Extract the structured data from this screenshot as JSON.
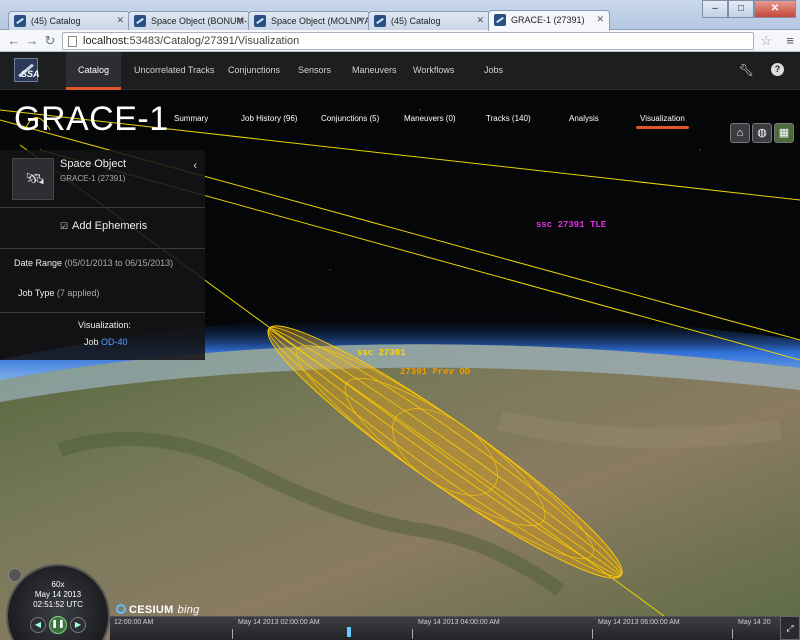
{
  "browser": {
    "tabs": [
      {
        "label": "(45) Catalog"
      },
      {
        "label": "Space Object (BONUM-1)"
      },
      {
        "label": "Space Object (MOLNIYA 1-"
      },
      {
        "label": "(45) Catalog"
      },
      {
        "label": "GRACE-1 (27391)"
      }
    ],
    "url_host": "localhost",
    "url_rest": ":53483/Catalog/27391/Visualization",
    "minimize": "–",
    "maximize": "□",
    "close": "✕"
  },
  "nav": {
    "items": [
      "Catalog",
      "Uncorrelated Tracks",
      "Conjunctions",
      "Sensors",
      "Maneuvers",
      "Workflows",
      "Jobs"
    ],
    "logo_text": "SSA",
    "help": "?"
  },
  "page": {
    "title": "GRACE-1",
    "subtabs": [
      "Summary",
      "Job History (96)",
      "Conjunctions (5)",
      "Maneuvers (0)",
      "Tracks (140)",
      "Analysis",
      "Visualization"
    ]
  },
  "panel": {
    "object_label": "Space Object",
    "object_sub": "GRACE-1 (27391)",
    "add_ephemeris": "Add Ephemeris",
    "date_range_label": "Date Range",
    "date_range_value": "(05/01/2013 to 06/15/2013)",
    "job_type_label": "Job Type",
    "job_type_value": "(7 applied)",
    "visualization_label": "Visualization:",
    "job_label": "Job",
    "job_link": "OD-40"
  },
  "scene": {
    "label_tle": "ssc 27391 TLE",
    "label_ssc": "ssc 27391",
    "label_prev": "27391 Prev OD"
  },
  "animation": {
    "speed": "60x",
    "date": "May 14 2013",
    "time": "02:51:52 UTC"
  },
  "credits": {
    "cesium": "CESIUM",
    "bing": "bing"
  },
  "timeline": {
    "labels": [
      "12:00:00 AM",
      "May 14 2013 02:00:00 AM",
      "May 14 2013 04:00:00 AM",
      "May 14 2013 06:00:00 AM",
      "May 14 20"
    ]
  },
  "colors": {
    "accent": "#e0572b",
    "orbit": "#e8d400",
    "ellipsoid": "#f5a800",
    "tle_label": "#e030e0",
    "od_label": "#f09a00"
  }
}
